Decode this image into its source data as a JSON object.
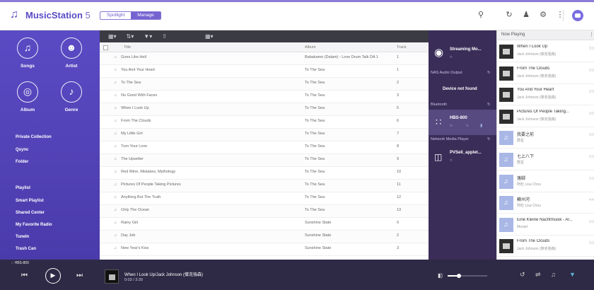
{
  "app": {
    "name": "MusicStation 5",
    "name_bold": "MusicStation",
    "name_version": " 5",
    "modes": [
      "Spotlight",
      "Manage"
    ],
    "active_mode": "Manage",
    "accent": "#8d7bd8"
  },
  "topbar": {
    "icons": [
      "search-icon",
      "refresh-icon",
      "user-icon",
      "settings-icon",
      "more-icon",
      "avatar"
    ]
  },
  "sidebar": {
    "categories": [
      {
        "label": "Songs",
        "icon": "music-note-icon"
      },
      {
        "label": "Artist",
        "icon": "artist-icon"
      },
      {
        "label": "Album",
        "icon": "album-icon"
      },
      {
        "label": "Genre",
        "icon": "guitar-icon"
      }
    ],
    "links": [
      "Private Collection",
      "Qsync",
      "Folder",
      "Playlist",
      "Smart Playlist",
      "Shared Center",
      "My Favorite Radio",
      "TuneIn",
      "Trash Can"
    ]
  },
  "list": {
    "toolbar_icons": [
      "view-icon",
      "sort-icon",
      "filter-icon",
      "upload-icon",
      "more-icon"
    ],
    "columns": {
      "title": "Title",
      "album": "Album",
      "track": "Track"
    },
    "rows": [
      {
        "title": "Goes Like Hell",
        "album": "Babakamo (Dalam) - Love Drum Talk DA 1",
        "track": "1"
      },
      {
        "title": "You And Your Heart",
        "album": "To The Sea",
        "track": "1"
      },
      {
        "title": "To The Sea",
        "album": "To The Sea",
        "track": "2"
      },
      {
        "title": "No Good With Faces",
        "album": "To The Sea",
        "track": "3"
      },
      {
        "title": "When I Look Up",
        "album": "To The Sea",
        "track": "5"
      },
      {
        "title": "From The Clouds",
        "album": "To The Sea",
        "track": "6"
      },
      {
        "title": "My Little Girl",
        "album": "To The Sea",
        "track": "7"
      },
      {
        "title": "Turn Your Love",
        "album": "To The Sea",
        "track": "8"
      },
      {
        "title": "The Upsetter",
        "album": "To The Sea",
        "track": "9"
      },
      {
        "title": "Red Wine, Mistakes, Mythology",
        "album": "To The Sea",
        "track": "10"
      },
      {
        "title": "Pictures Of People Taking Pictures",
        "album": "To The Sea",
        "track": "11"
      },
      {
        "title": "Anything But The Truth",
        "album": "To The Sea",
        "track": "12"
      },
      {
        "title": "Only The Ocean",
        "album": "To The Sea",
        "track": "13"
      },
      {
        "title": "Rainy Girl",
        "album": "Sunshine State",
        "track": "0"
      },
      {
        "title": "Day Job",
        "album": "Sunshine State",
        "track": "2"
      },
      {
        "title": "New Year's Kiss",
        "album": "Sunshine State",
        "track": "3"
      }
    ]
  },
  "output": {
    "streaming_label": "Streaming Mo...",
    "sections": [
      "NAS Audio Output",
      "Bluetooth",
      "Network Media Player"
    ],
    "device_not_found": "Device not found",
    "bluetooth_device": "HBS-800",
    "network_device": "PVSeli_applet..."
  },
  "now_playing": {
    "title": "Now Playing",
    "items": [
      {
        "name": "When I Look Up",
        "artist": "Jack Johnson (傑克強森)",
        "dur": "3:3",
        "thumb": "dark"
      },
      {
        "name": "From The Clouds",
        "artist": "Jack Johnson (傑克強森)",
        "dur": "3:3",
        "thumb": "dark"
      },
      {
        "name": "You And Your Heart",
        "artist": "Jack Johnson (傑克強森)",
        "dur": "3:3",
        "thumb": "dark"
      },
      {
        "name": "Pictures Of People Taking...",
        "artist": "Jack Johnson (傑克強森)",
        "dur": "3:3",
        "thumb": "dark"
      },
      {
        "name": "我要之前",
        "artist": "群星",
        "dur": "3:3",
        "thumb": "light"
      },
      {
        "name": "七上八下",
        "artist": "群星",
        "dur": "3:3",
        "thumb": "light"
      },
      {
        "name": "落脚",
        "artist": "阿杜 Lisa Chou",
        "dur": "3:3",
        "thumb": "light"
      },
      {
        "name": "蘇州河",
        "artist": "阿杜 Lisa Chou",
        "dur": "4:4",
        "thumb": "light"
      },
      {
        "name": "Eine Kleine Nachtmusik - Al...",
        "artist": "Mozart",
        "dur": "3:3",
        "thumb": "light"
      },
      {
        "name": "From The Clouds",
        "artist": "Jack Johnson (傑克強森)",
        "dur": "3:3",
        "thumb": "dark"
      }
    ]
  },
  "player": {
    "device": "HBS-800",
    "song": "When I Look Up/Jack Johnson (傑克強森)",
    "time": "0:03 / 3:30",
    "volume_fraction": 0.28
  }
}
